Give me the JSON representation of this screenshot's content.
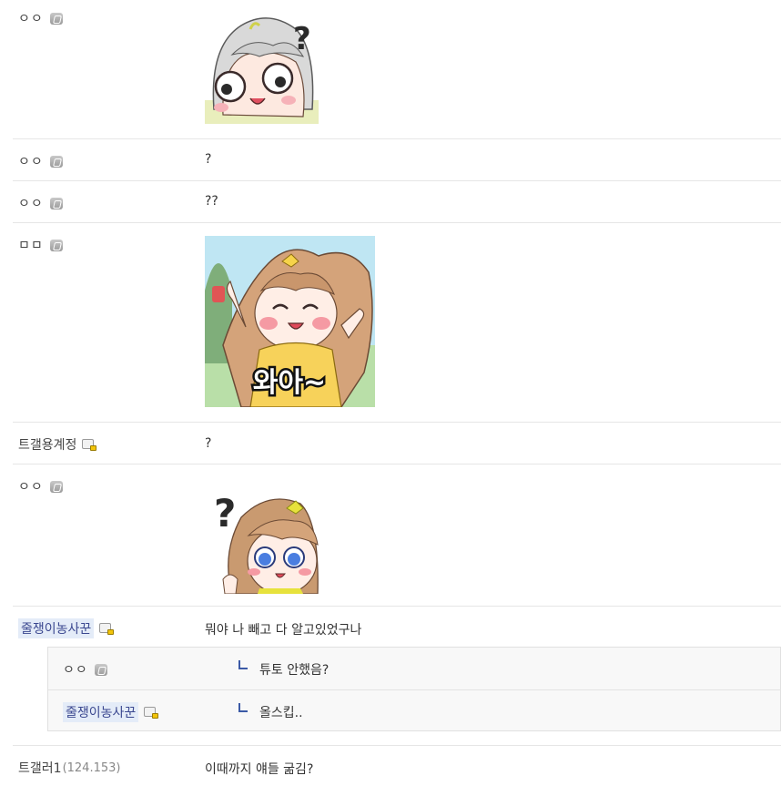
{
  "comments": [
    {
      "nick": "ㅇㅇ",
      "badge": "gray-g-icon",
      "type": "dccon",
      "dccon": "silver-hair-girl-question-sticker"
    },
    {
      "nick": "ㅇㅇ",
      "badge": "gray-g-icon",
      "type": "text",
      "text": "?"
    },
    {
      "nick": "ㅇㅇ",
      "badge": "gray-g-icon",
      "type": "text",
      "text": "??"
    },
    {
      "nick": "ㅁㅁ",
      "badge": "gray-g-icon",
      "type": "dccon",
      "dccon": "brown-hair-girl-waa-sticker",
      "sticker_caption": "와아~"
    },
    {
      "nick": "트갤용계정",
      "badge": "fixed-nick-lock-icon",
      "type": "text",
      "text": "?"
    },
    {
      "nick": "ㅇㅇ",
      "badge": "gray-g-icon",
      "type": "dccon",
      "dccon": "brown-hair-girl-question-sticker"
    },
    {
      "nick": "줄쟁이농사꾼",
      "badge": "fixed-nick-lock-icon",
      "type": "text",
      "text": "뭐야 나 빼고 다 알고있었구나"
    },
    {
      "nick": "트갤러1",
      "ip": "(124.153)",
      "type": "text",
      "text": "이때까지 얘들 굶김?"
    }
  ],
  "replies": [
    {
      "nick": "ㅇㅇ",
      "badge": "gray-g-icon",
      "text": "튜토 안했음?"
    },
    {
      "nick": "줄쟁이농사꾼",
      "badge": "fixed-nick-lock-icon",
      "text": "올스킵.."
    }
  ],
  "colors": {
    "divider": "#e6e6e6",
    "reply_bg": "#f8f8f8",
    "reply_arrow": "#3b5aa6",
    "nick_highlight": "#e4ecf8"
  }
}
